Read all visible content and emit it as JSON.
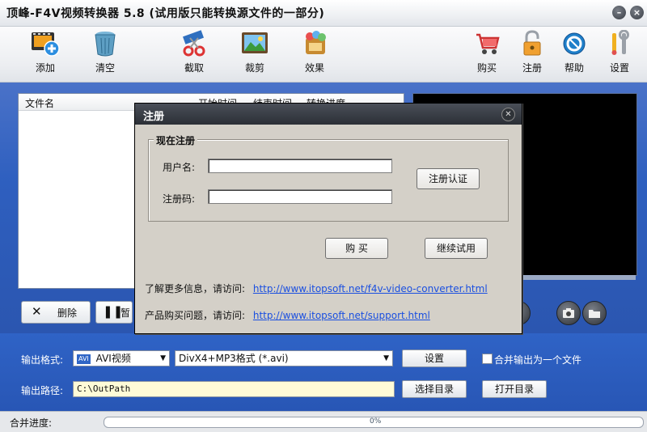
{
  "window": {
    "title": "顶峰-F4V视频转换器 5.8 (试用版只能转换源文件的一部分)"
  },
  "toolbar": {
    "left": [
      {
        "label": "添加",
        "icon": "film-add-icon"
      },
      {
        "label": "清空",
        "icon": "trash-bin-icon"
      },
      {
        "label": "截取",
        "icon": "scissors-film-icon"
      },
      {
        "label": "裁剪",
        "icon": "crop-image-icon"
      },
      {
        "label": "效果",
        "icon": "effects-icon"
      }
    ],
    "right": [
      {
        "label": "购买",
        "icon": "shopping-cart-icon"
      },
      {
        "label": "注册",
        "icon": "lock-icon"
      },
      {
        "label": "帮助",
        "icon": "help-icon"
      },
      {
        "label": "设置",
        "icon": "tools-icon"
      }
    ]
  },
  "filelist": {
    "col_name": "文件名",
    "col_start": "开始时间",
    "col_end": "结束时间",
    "col_progress": "转换进度"
  },
  "controls": {
    "delete_label": "删除",
    "pause_label": "暂"
  },
  "output": {
    "format_label": "输出格式:",
    "format_value": "AVI视频",
    "format_badge": "AVI",
    "codec_value": "DivX4+MP3格式 (*.avi)",
    "settings_button": "设置",
    "merge_label": "合并输出为一个文件",
    "path_label": "输出路径:",
    "path_value": "C:\\OutPath",
    "choose_dir_button": "选择目录",
    "open_dir_button": "打开目录"
  },
  "status": {
    "merge_progress_label": "合并进度:",
    "progress_text": "0%",
    "progress_value": 0
  },
  "dialog": {
    "title": "注册",
    "group_label": "现在注册",
    "username_label": "用户名:",
    "username_value": "",
    "code_label": "注册码:",
    "code_value": "",
    "verify_button": "注册认证",
    "buy_button": "购  买",
    "continue_button": "继续试用",
    "more_info_text": "了解更多信息，请访问:",
    "more_info_link": "http://www.itopsoft.net/f4v-video-converter.html",
    "purchase_text": "产品购买问题，请访问:",
    "purchase_link": "http://www.itopsoft.net/support.html"
  }
}
